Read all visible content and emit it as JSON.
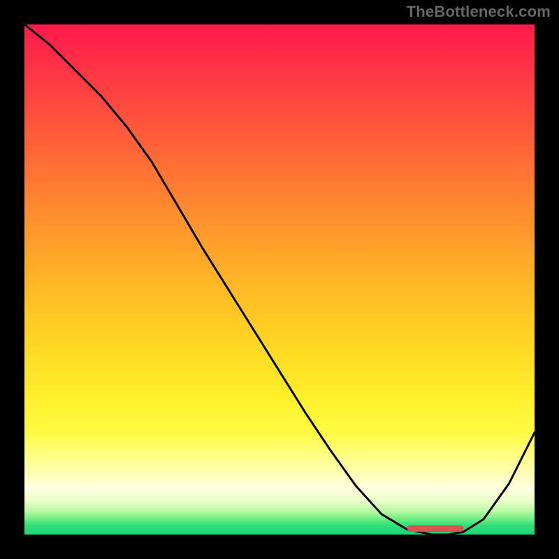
{
  "watermark": "TheBottleneck.com",
  "colors": {
    "marker": "#d9534f",
    "curve": "#000000"
  },
  "chart_data": {
    "type": "line",
    "title": "",
    "xlabel": "",
    "ylabel": "",
    "xlim": [
      0,
      100
    ],
    "ylim": [
      0,
      100
    ],
    "x": [
      0,
      5,
      10,
      15,
      20,
      25,
      30,
      35,
      40,
      45,
      50,
      55,
      60,
      65,
      70,
      75,
      80,
      83,
      86,
      90,
      95,
      100
    ],
    "values": [
      100,
      96,
      91,
      86,
      80,
      73,
      64.5,
      56,
      48,
      40,
      32,
      24,
      16.5,
      9.5,
      4,
      1,
      0,
      0,
      0.5,
      3,
      10,
      20
    ],
    "optimal_range_x": [
      75,
      86
    ],
    "notes": "Single black curve over a vertical rainbow gradient (red at top through yellow to green at the very bottom). Minimum plateau around x≈75–86 marked by a small rounded red bar near y≈0."
  }
}
